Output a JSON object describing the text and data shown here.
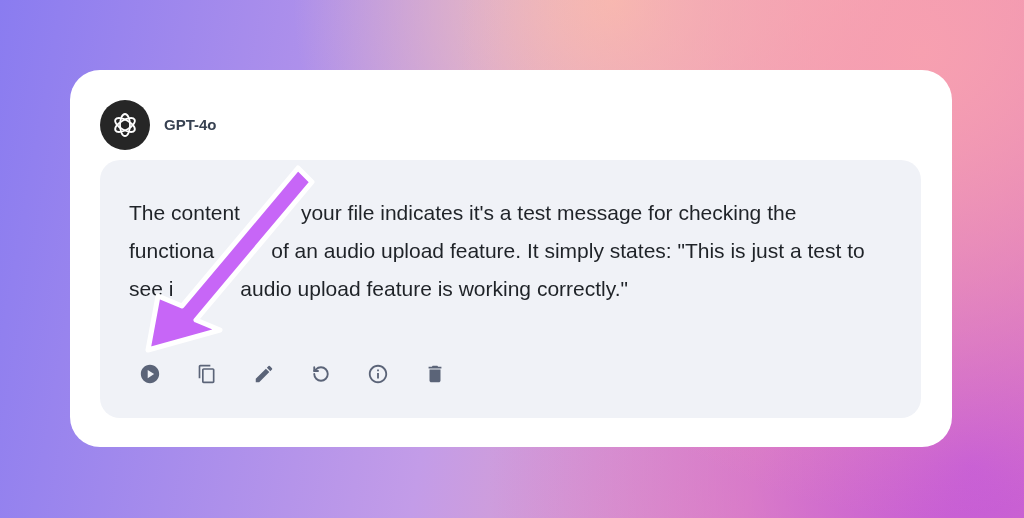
{
  "message": {
    "sender": "GPT-4o",
    "lines": [
      [
        "The content",
        "your file indicates it's a test message for checking the"
      ],
      [
        "functiona",
        "of an audio upload feature. It simply states: \"This is just a test to"
      ],
      [
        "see i",
        "audio upload feature is working correctly.\""
      ]
    ]
  }
}
